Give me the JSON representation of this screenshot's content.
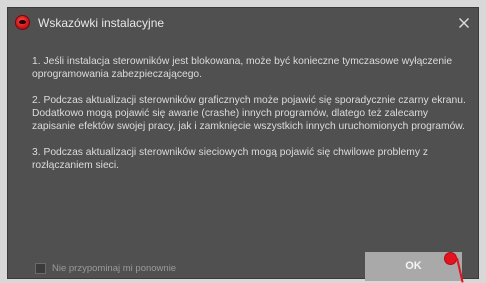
{
  "window": {
    "title": "Wskazówki instalacyjne"
  },
  "content": {
    "paragraphs": [
      "1. Jeśli instalacja sterowników jest blokowana, może być konieczne tymczasowe wyłączenie oprogramowania zabezpieczającego.",
      "2. Podczas aktualizacji sterowników graficznych może pojawić się sporadycznie czarny ekranu. Dodatkowo mogą pojawić się awarie (crashe) innych programów, dlatego też zalecamy zapisanie efektów swojej pracy, jak i zamknięcie wszystkich innych uruchomionych programów.",
      "3. Podczas aktualizacji sterowników sieciowych mogą pojawić się chwilowe problemy z rozłączaniem sieci."
    ]
  },
  "footer": {
    "checkbox_label": "Nie przypominaj mi ponownie",
    "checkbox_checked": false,
    "ok_label": "OK"
  },
  "colors": {
    "dialog_bg": "#505050",
    "ok_button_bg": "#a9a9a9",
    "click_marker": "#e4131f",
    "app_icon": "#c8151d"
  },
  "icons": {
    "app": "msi-dragon-icon",
    "close": "close-icon"
  }
}
